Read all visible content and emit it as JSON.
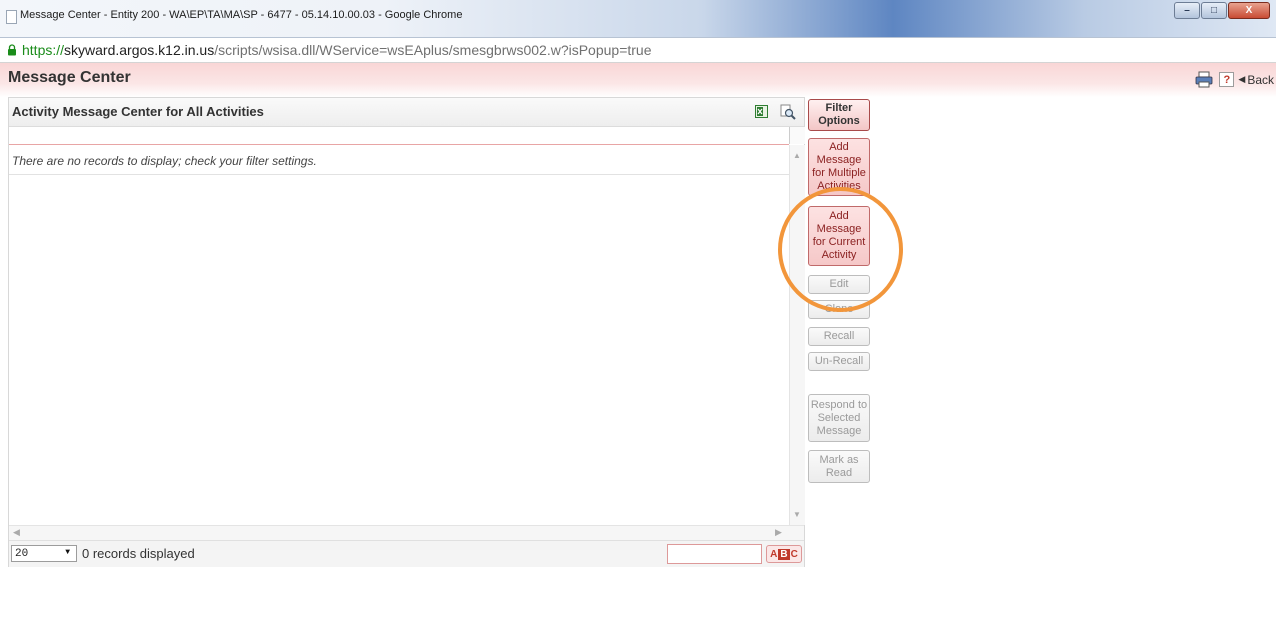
{
  "window": {
    "title": "Message Center - Entity 200 - WA\\EP\\TA\\MA\\SP - 6477 - 05.14.10.00.03 - Google Chrome",
    "minimize_label": "–",
    "maximize_label": "□",
    "close_label": "X"
  },
  "address": {
    "scheme": "https://",
    "host": "skyward.argos.k12.in.us",
    "path": "/scripts/wsisa.dll/WService=wsEAplus/smesgbrws002.w?isPopup=true"
  },
  "header": {
    "title": "Message Center",
    "help_label": "?",
    "back_label": "Back"
  },
  "grid": {
    "title": "Activity Message Center for All Activities",
    "empty_message": "There are no records to display; check your filter settings.",
    "page_size": "20",
    "records_label": "0 records displayed",
    "abc_label": [
      "A",
      "B",
      "C"
    ]
  },
  "actions": {
    "filter": "Filter Options",
    "add_multiple": "Add Message for Multiple Activities",
    "add_current": "Add Message for Current Activity",
    "edit": "Edit",
    "clone": "Clone",
    "recall": "Recall",
    "unrecall": "Un-Recall",
    "respond": "Respond to Selected Message",
    "mark_read": "Mark as Read"
  },
  "colors": {
    "highlight_ring": "#f2963b",
    "header_tint": "#f9d6d6",
    "active_button": "#f5c8c8"
  }
}
